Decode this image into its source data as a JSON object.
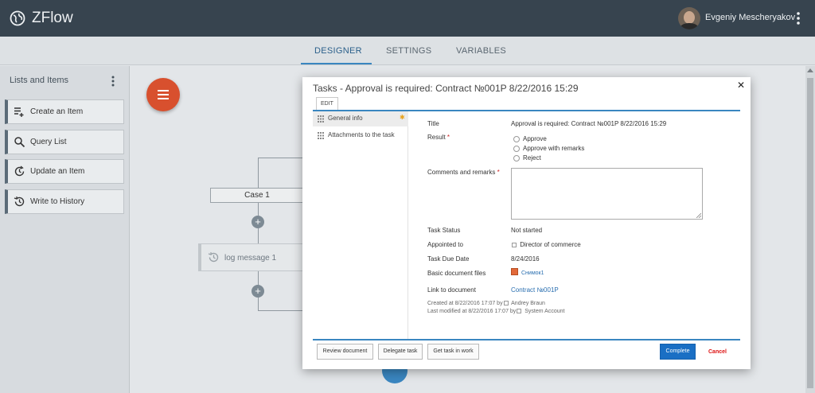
{
  "app": {
    "title": "ZFlow",
    "user_name": "Evgeniy Mescheryakov"
  },
  "tabs": [
    {
      "label": "DESIGNER",
      "active": true
    },
    {
      "label": "SETTINGS",
      "active": false
    },
    {
      "label": "VARIABLES",
      "active": false
    }
  ],
  "left_panel": {
    "title": "Lists and Items",
    "items": [
      {
        "label": "Create an Item",
        "icon": "list-add-icon"
      },
      {
        "label": "Query List",
        "icon": "search-icon"
      },
      {
        "label": "Update an Item",
        "icon": "update-clock-icon"
      },
      {
        "label": "Write to History",
        "icon": "history-icon"
      }
    ]
  },
  "canvas": {
    "case_label": "Case 1",
    "log_label": "log message 1"
  },
  "modal": {
    "title": "Tasks - Approval is required: Contract №001P 8/22/2016 15:29",
    "edit_tab": "EDIT",
    "nav": [
      {
        "label": "General info",
        "selected": true
      },
      {
        "label": "Attachments to the task",
        "selected": false
      }
    ],
    "fields": {
      "title_label": "Title",
      "title_value": "Approval is required: Contract №001P 8/22/2016 15:29",
      "result_label": "Result",
      "result_options": [
        "Approve",
        "Approve with remarks",
        "Reject"
      ],
      "comments_label": "Comments and remarks",
      "comments_value": "",
      "status_label": "Task Status",
      "status_value": "Not started",
      "appointed_label": "Appointed to",
      "appointed_value": "Director of commerce",
      "due_label": "Task Due Date",
      "due_value": "8/24/2016",
      "files_label": "Basic document files",
      "files_value": "Снимок1",
      "link_label": "Link to document",
      "link_value": "Contract №001P"
    },
    "meta": {
      "created_prefix": "Created at 8/22/2016 17:07 by",
      "created_by": "Andrey Braun",
      "modified_prefix": "Last modified at 8/22/2016 17:07 by",
      "modified_by": "System Account"
    },
    "buttons": {
      "review": "Review document",
      "delegate": "Delegate task",
      "get_in_work": "Get task in work",
      "complete": "Complete",
      "cancel": "Cancel"
    }
  },
  "colors": {
    "topbar": "#37444f",
    "accent": "#3a86c0",
    "fab": "#d8502e",
    "complete_button": "#1a6fc4",
    "cancel_text": "#dd1111"
  }
}
